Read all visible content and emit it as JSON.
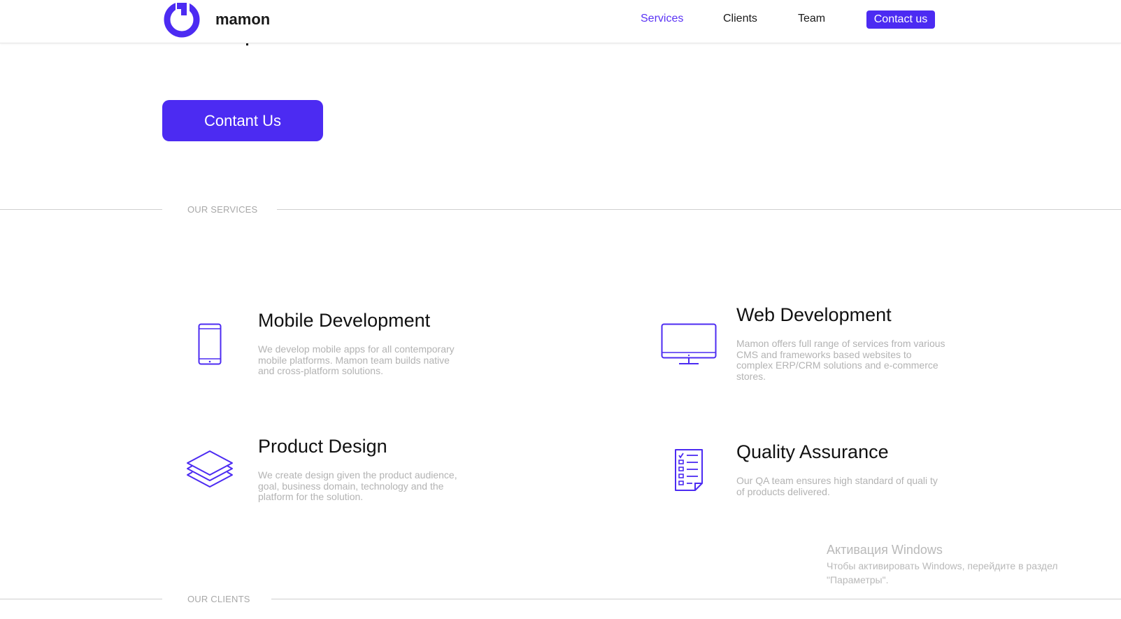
{
  "brand": {
    "name": "mamon",
    "accent_color": "#4c2bf2"
  },
  "nav": {
    "items": [
      {
        "label": "Services",
        "active": true
      },
      {
        "label": "Clients",
        "active": false
      },
      {
        "label": "Team",
        "active": false
      }
    ],
    "cta_label": "Contact us"
  },
  "hero": {
    "button_label": "Contant Us"
  },
  "services_section": {
    "label": "OUR SERVICES",
    "items": [
      {
        "icon": "smartphone-icon",
        "title": "Mobile Development",
        "description": "We develop mobile apps for all contemporary mobile platforms. Mamon team builds native and cross-platform solutions."
      },
      {
        "icon": "monitor-icon",
        "title": "Web Development",
        "description": "Mamon offers full range of services from various CMS and frameworks based websites to complex ERP/CRM solutions and e-commerce stores."
      },
      {
        "icon": "layers-icon",
        "title": "Product Design",
        "description": "We create design given the product audience, goal, business domain, technology and the platform for the solution."
      },
      {
        "icon": "checklist-icon",
        "title": "Quality Assurance",
        "description": "Our QA team ensures high standard of quali ty of products delivered."
      }
    ]
  },
  "clients_section": {
    "label": "OUR CLIENTS"
  },
  "windows_watermark": {
    "title": "Активация Windows",
    "text": "Чтобы активировать Windows, перейдите в раздел \"Параметры\"."
  }
}
